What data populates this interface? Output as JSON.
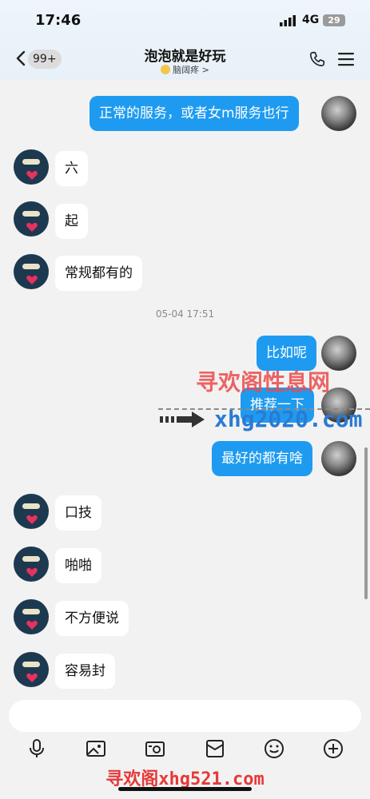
{
  "status_bar": {
    "time": "17:46",
    "network": "4G",
    "battery": "29"
  },
  "header": {
    "unread_count": "99+",
    "title": "泡泡就是好玩",
    "subtitle": "脑阔疼 >"
  },
  "messages": [
    {
      "side": "out",
      "text": "正常的服务，或者女m服务也行"
    },
    {
      "side": "in",
      "text": "六"
    },
    {
      "side": "in",
      "text": "起"
    },
    {
      "side": "in",
      "text": "常规都有的"
    },
    {
      "side": "out",
      "text": "比如呢"
    },
    {
      "side": "out",
      "text": "推荐一下"
    },
    {
      "side": "out",
      "text": "最好的都有啥"
    },
    {
      "side": "in",
      "text": "口技"
    },
    {
      "side": "in",
      "text": "啪啪"
    },
    {
      "side": "in",
      "text": "不方便说"
    },
    {
      "side": "in",
      "text": "容易封"
    }
  ],
  "timestamp": "05-04 17:51",
  "watermarks": {
    "top": "寻欢阁性息网",
    "url": "xhg2020.com",
    "bottom": "寻欢阁xhg521.com"
  },
  "toolbar": {
    "icons": [
      "microphone-icon",
      "image-icon",
      "camera-icon",
      "red-packet-icon",
      "emoji-icon",
      "plus-icon"
    ]
  },
  "colors": {
    "accent": "#1e9bf0",
    "background": "#f2f2f2",
    "watermark_red": "#e53939"
  }
}
